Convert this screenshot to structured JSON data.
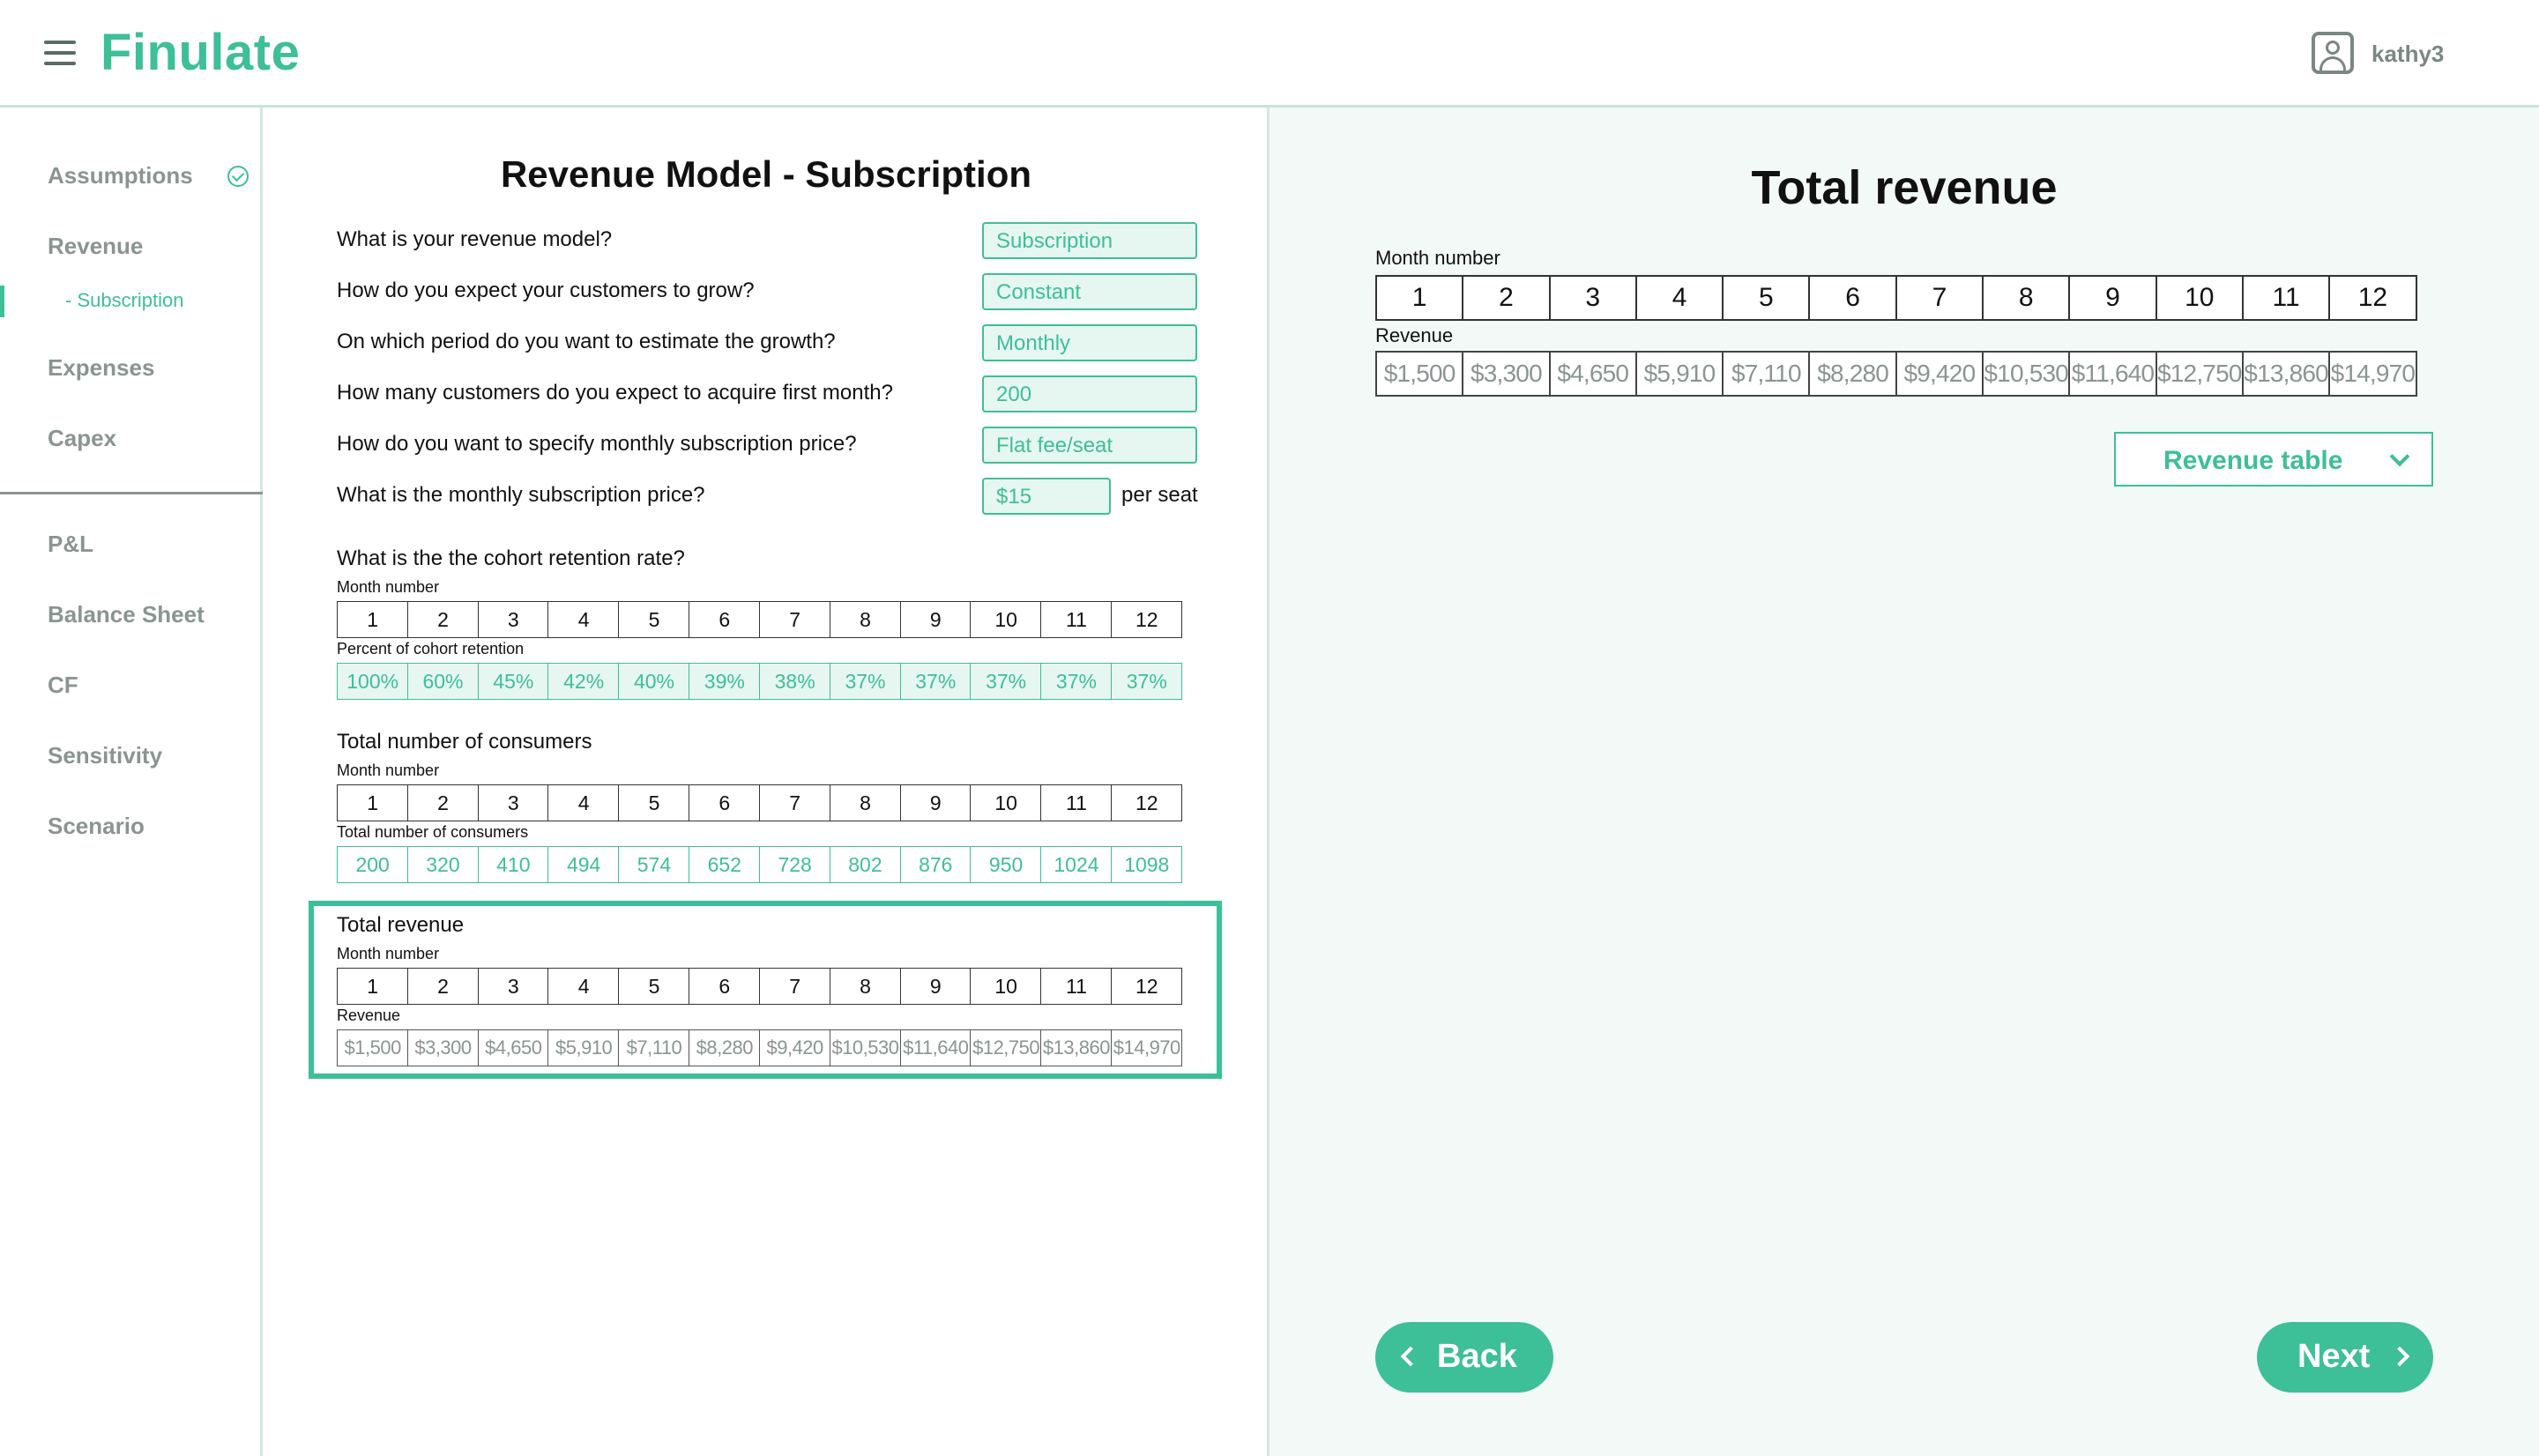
{
  "app": {
    "logo": "Finulate",
    "username": "kathy3"
  },
  "sidebar": {
    "items": [
      {
        "label": "Assumptions"
      },
      {
        "label": "Revenue"
      },
      {
        "label": "- Subscription"
      },
      {
        "label": "Expenses"
      },
      {
        "label": "Capex"
      },
      {
        "label": "P&L"
      },
      {
        "label": "Balance Sheet"
      },
      {
        "label": "CF"
      },
      {
        "label": "Sensitivity"
      },
      {
        "label": "Scenario"
      }
    ]
  },
  "form": {
    "title": "Revenue Model - Subscription",
    "questions": [
      {
        "label": "What is your revenue model?",
        "value": "Subscription"
      },
      {
        "label": "How do you expect your customers to grow?",
        "value": "Constant"
      },
      {
        "label": "On which period do you want to estimate the growth?",
        "value": "Monthly"
      },
      {
        "label": "How many customers do you expect to acquire first month?",
        "value": "200"
      },
      {
        "label": "How do you want to specify monthly subscription price?",
        "value": "Flat fee/seat"
      },
      {
        "label": "What is the monthly subscription price?",
        "value": "$15",
        "suffix": "per seat"
      }
    ],
    "months": [
      "1",
      "2",
      "3",
      "4",
      "5",
      "6",
      "7",
      "8",
      "9",
      "10",
      "11",
      "12"
    ],
    "month_number_label": "Month number",
    "retention": {
      "title": "What is the the cohort retention rate?",
      "row_label": "Percent of cohort retention",
      "values": [
        "100%",
        "60%",
        "45%",
        "42%",
        "40%",
        "39%",
        "38%",
        "37%",
        "37%",
        "37%",
        "37%",
        "37%"
      ]
    },
    "consumers": {
      "title": "Total number of consumers",
      "row_label": "Total number of consumers",
      "values": [
        "200",
        "320",
        "410",
        "494",
        "574",
        "652",
        "728",
        "802",
        "876",
        "950",
        "1024",
        "1098"
      ]
    },
    "revenue": {
      "title": "Total revenue",
      "row_label": "Revenue",
      "values": [
        "$1,500",
        "$3,300",
        "$4,650",
        "$5,910",
        "$7,110",
        "$8,280",
        "$9,420",
        "$10,530",
        "$11,640",
        "$12,750",
        "$13,860",
        "$14,970"
      ]
    }
  },
  "right": {
    "title": "Total revenue",
    "month_number_label": "Month number",
    "revenue_label": "Revenue",
    "dropdown": "Revenue table",
    "back": "Back",
    "next": "Next"
  },
  "colors": {
    "accent": "#3dbf97",
    "accent_light": "#e6f6f1",
    "muted": "#8a9592"
  }
}
